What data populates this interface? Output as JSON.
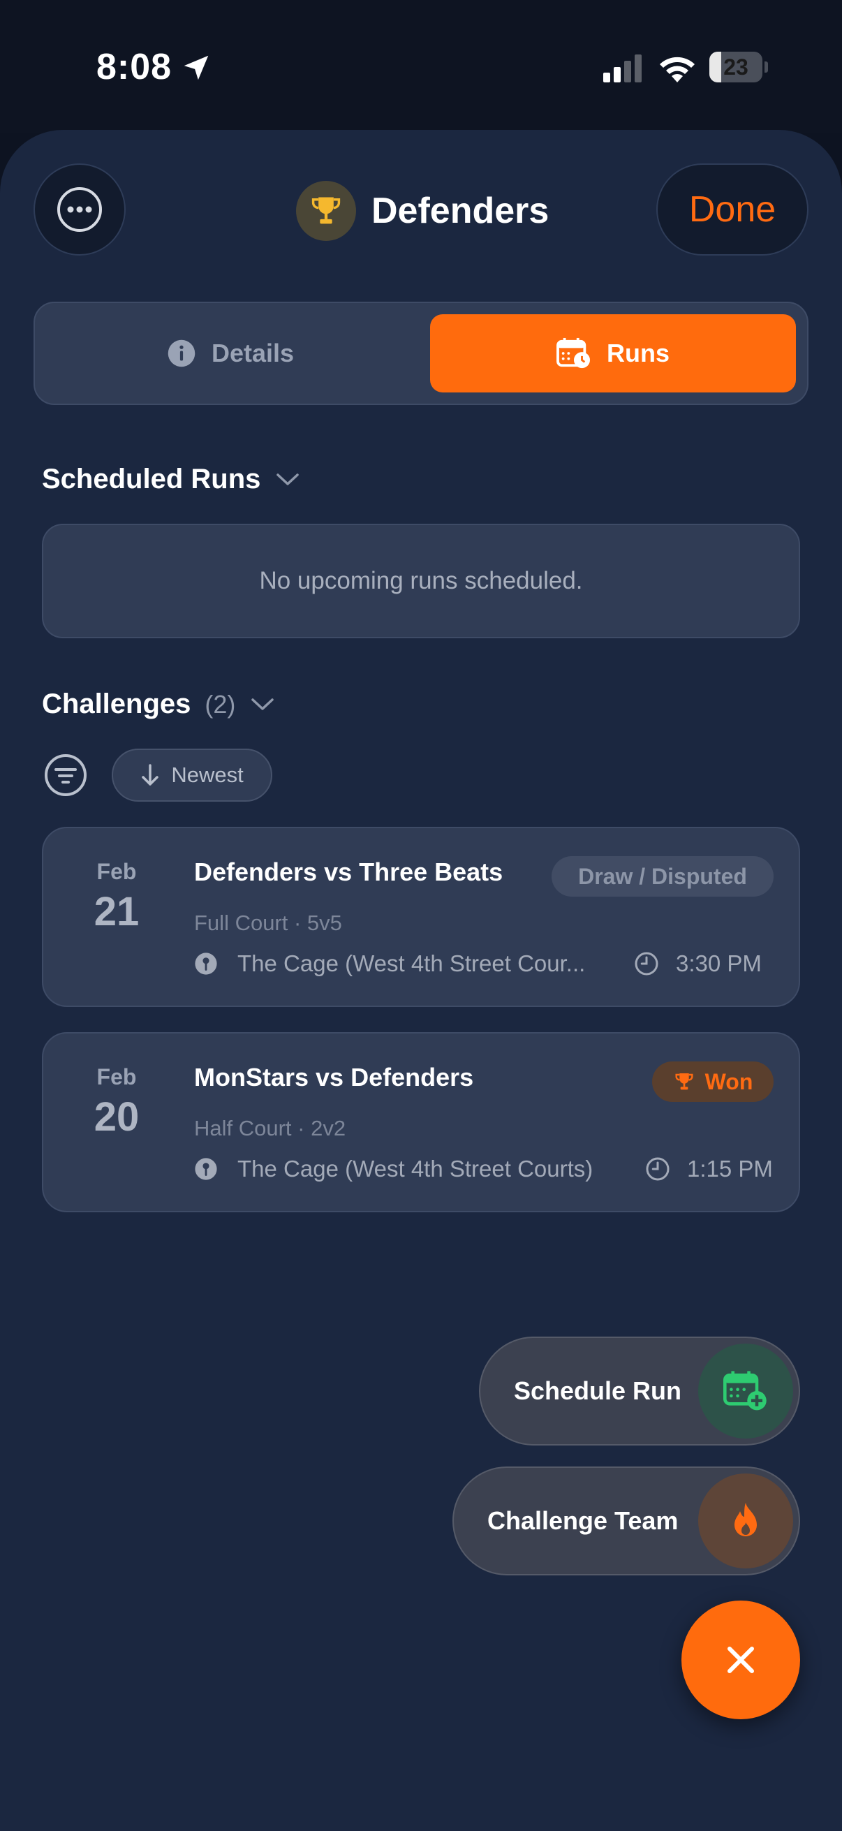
{
  "status_bar": {
    "time": "8:08",
    "battery_level": "23",
    "battery_fraction": 0.23
  },
  "header": {
    "title": "Defenders",
    "done_label": "Done"
  },
  "tabs": {
    "details_label": "Details",
    "runs_label": "Runs",
    "active": "Runs"
  },
  "scheduled": {
    "title": "Scheduled Runs",
    "empty_message": "No upcoming runs scheduled."
  },
  "challenges": {
    "title": "Challenges",
    "count": "(2)",
    "sort_label": "Newest",
    "items": [
      {
        "month": "Feb",
        "day": "21",
        "title": "Defenders vs Three Beats",
        "meta": "Full Court · 5v5",
        "location": "The Cage (West 4th Street Cour...",
        "time": "3:30 PM",
        "status": "Draw / Disputed"
      },
      {
        "month": "Feb",
        "day": "20",
        "title": "MonStars vs Defenders",
        "meta": "Half Court · 2v2",
        "location": "The Cage (West 4th Street Courts)",
        "time": "1:15 PM",
        "status": "Won"
      }
    ]
  },
  "fab": {
    "schedule_run_label": "Schedule Run",
    "challenge_team_label": "Challenge Team"
  },
  "colors": {
    "accent": "#ff6b0d",
    "sheet": "#1b2740",
    "card": "#303c55",
    "schedule_green": "#2ecc71"
  }
}
